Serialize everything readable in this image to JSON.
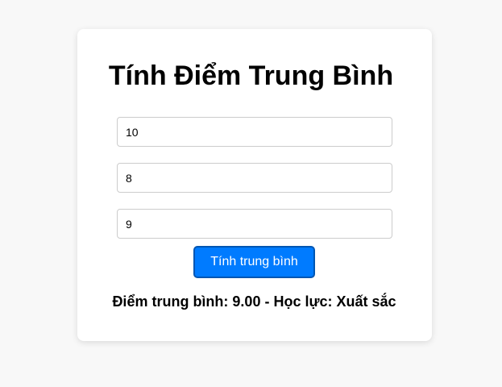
{
  "app": {
    "title": "Tính Điểm Trung Bình"
  },
  "form": {
    "inputs": [
      {
        "value": "10"
      },
      {
        "value": "8"
      },
      {
        "value": "9"
      }
    ],
    "button_label": "Tính trung bình"
  },
  "result": {
    "text": "Điểm trung bình: 9.00 - Học lực: Xuất sắc"
  },
  "colors": {
    "background": "#f8f8f8",
    "card": "#ffffff",
    "button": "#007bff",
    "button_border": "#0056b3"
  }
}
